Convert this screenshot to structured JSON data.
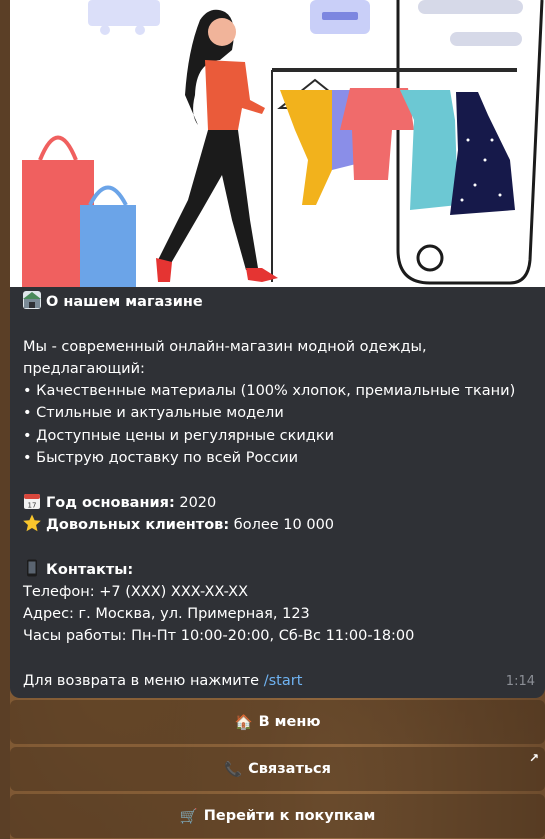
{
  "message": {
    "title": "О нашем магазине",
    "intro_1": "Мы - современный онлайн-магазин модной одежды,",
    "intro_2": "предлагающий:",
    "bullets": [
      "• Качественные материалы (100% хлопок, премиальные ткани)",
      "• Стильные и актуальные модели",
      "• Доступные цены и регулярные скидки",
      "• Быструю доставку по всей России"
    ],
    "founded_label": "Год основания:",
    "founded_value": " 2020",
    "clients_label": "Довольных клиентов:",
    "clients_value": " более 10 000",
    "contacts_label": "Контакты:",
    "phone": "Телефон: +7 (XXX) XXX-XX-XX",
    "address": "Адрес: г. Москва, ул. Примерная, 123",
    "hours": "Часы работы: Пн-Пт 10:00-20:00, Сб-Вс 11:00-18:00",
    "return_text": "Для возврата в меню нажмите ",
    "return_cmd": "/start",
    "time": "1:14"
  },
  "keyboard": {
    "menu": {
      "icon": "🏠",
      "label": "В меню"
    },
    "contact": {
      "icon": "📞",
      "label": "Связаться",
      "corner": "↗"
    },
    "shop": {
      "icon": "🛒",
      "label": "Перейти к покупкам"
    }
  },
  "icons": {
    "title_icon": "store-icon",
    "calendar_icon": "calendar-icon",
    "star_icon": "star-icon",
    "phone_icon": "mobile-phone-icon"
  }
}
